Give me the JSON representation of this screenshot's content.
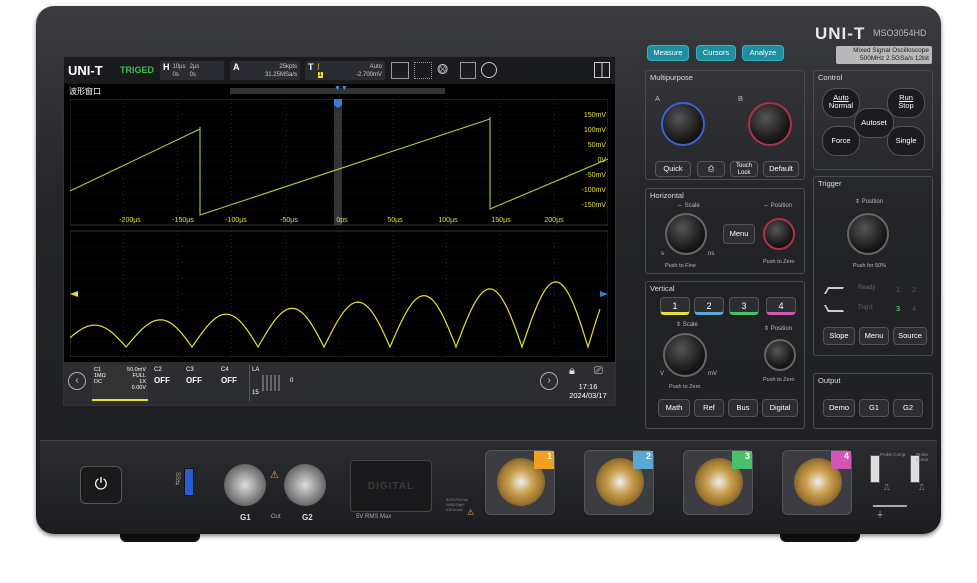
{
  "device": {
    "brand": "UNI-T",
    "model": "MSO3054HD",
    "subtitle_line1": "Mixed Signal Oscilloscope",
    "subtitle_line2": "500MHz  2.5GSa/s  12bit"
  },
  "screen": {
    "logo": "UNI-T",
    "trig_state": "TRIGED",
    "horizontal": {
      "label": "H",
      "scale": "10µs",
      "offset": "0s",
      "scale2": "2µs",
      "offset2": "0s"
    },
    "acquire": {
      "label": "A",
      "points": "25kpts",
      "rate": "31.25MSa/s"
    },
    "trigger": {
      "label": "T",
      "mode": "Auto",
      "level": "-2.700mV",
      "source": "1"
    },
    "window_title": "波形窗口",
    "volt_labels": [
      "150mV",
      "100mV",
      "50mV",
      "0V",
      "-50mV",
      "-100mV",
      "-150mV"
    ],
    "time_labels": [
      "-200µs",
      "-150µs",
      "-100µs",
      "-50µs",
      "0ps",
      "50µs",
      "100µs",
      "150µs",
      "200µs"
    ],
    "channels": [
      {
        "name": "C1",
        "scale": "50.0mV",
        "imp": "1MΩ",
        "bw": "FULL",
        "coupling": "DC",
        "probe": "1X",
        "offset": "0.00V"
      },
      {
        "name": "C2",
        "state": "OFF"
      },
      {
        "name": "C3",
        "state": "OFF"
      },
      {
        "name": "C4",
        "state": "OFF"
      },
      {
        "name": "LA",
        "d0": "0",
        "d15": "15"
      }
    ],
    "time": "17:16",
    "date": "2024/03/17"
  },
  "panel": {
    "tabs": [
      "Measure",
      "Cursors",
      "Analyze"
    ],
    "multipurpose": {
      "title": "Multipurpose",
      "knob_a": "A",
      "knob_b": "B",
      "buttons": [
        "Quick",
        "Touch Lock",
        "Default"
      ]
    },
    "control": {
      "title": "Control",
      "auto": "Auto",
      "normal": "Normal",
      "run": "Run",
      "stop": "Stop",
      "autoset": "Autoset",
      "force": "Force",
      "single": "Single"
    },
    "horizontal": {
      "title": "Horizontal",
      "scale": "⇔ Scale",
      "position": "⇔ Position",
      "menu": "Menu",
      "push_fine": "Push to Fine",
      "push_zero": "Push to Zero",
      "s": "s",
      "ns": "ns"
    },
    "trigger": {
      "title": "Trigger",
      "position": "⇕ Position",
      "push50": "Push for 50%",
      "ready": "Ready",
      "trigd": "Trig'd",
      "n1": "1",
      "n2": "2",
      "n3": "3",
      "n4": "4",
      "slope": "Slope",
      "menu": "Menu",
      "source": "Source"
    },
    "vertical": {
      "title": "Vertical",
      "channels": [
        "1",
        "2",
        "3",
        "4"
      ],
      "scale": "⇕ Scale",
      "position": "⇕ Position",
      "push_zero": "Push to Zero",
      "push_zero2": "Push to Zero",
      "v": "V",
      "mv": "mV",
      "buttons": [
        "Math",
        "Ref",
        "Bus",
        "Digital"
      ]
    },
    "output": {
      "title": "Output",
      "buttons": [
        "Demo",
        "G1",
        "G2"
      ]
    }
  },
  "front": {
    "usb": "SS⇆",
    "gen_label_g1": "G1",
    "gen_label_out": "Out",
    "gen_label_g2": "G2",
    "digital": "DIGITAL",
    "digital_rms": "5V RMS Max",
    "input_spec": [
      "300V/5Vrms",
      "1MΩ/18pF",
      "≤30Vmax"
    ],
    "channel_tags": [
      "1",
      "2",
      "3",
      "4"
    ],
    "probe_comp": "Probe Comp",
    "probe_comp2": "Probe Comp"
  },
  "colors": {
    "ch1": "#e6e033",
    "ch2": "#5aa8d6",
    "ch3": "#49c06a",
    "ch4": "#d455b8",
    "ch1_tag": "#f2a020",
    "tab": "#1d8fa0"
  }
}
